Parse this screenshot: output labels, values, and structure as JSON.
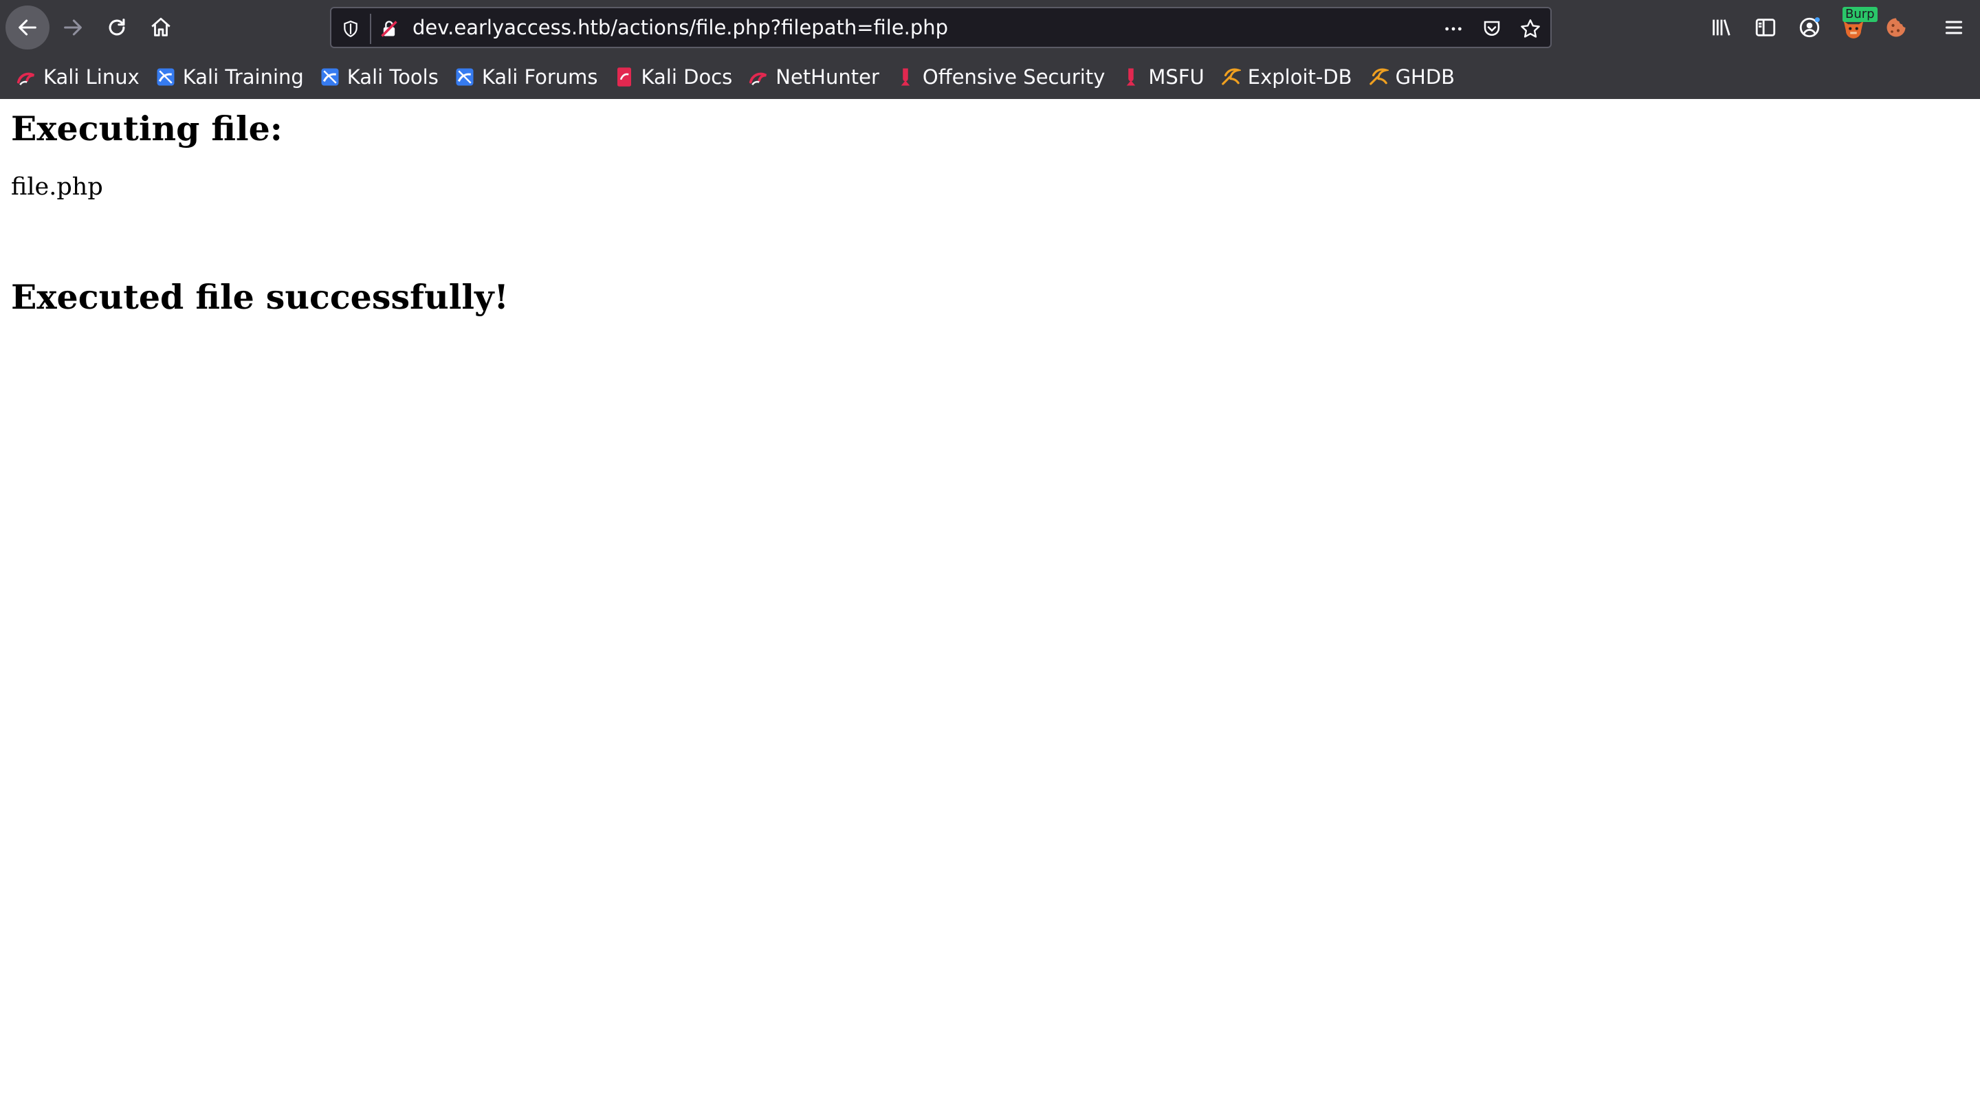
{
  "browser": {
    "url": "dev.earlyaccess.htb/actions/file.php?filepath=file.php",
    "burp_badge": "Burp",
    "accent_colors": {
      "chrome_bg": "#38383d",
      "url_bg": "#1c1b22",
      "burp_green": "#2ac769"
    }
  },
  "bookmarks": [
    {
      "label": "Kali Linux",
      "icon": "kali-dragon-icon"
    },
    {
      "label": "Kali Training",
      "icon": "kali-training-icon"
    },
    {
      "label": "Kali Tools",
      "icon": "kali-tools-icon"
    },
    {
      "label": "Kali Forums",
      "icon": "kali-forums-icon"
    },
    {
      "label": "Kali Docs",
      "icon": "kali-docs-icon"
    },
    {
      "label": "NetHunter",
      "icon": "nethunter-icon"
    },
    {
      "label": "Offensive Security",
      "icon": "offsec-icon"
    },
    {
      "label": "MSFU",
      "icon": "msfu-icon"
    },
    {
      "label": "Exploit-DB",
      "icon": "exploitdb-icon"
    },
    {
      "label": "GHDB",
      "icon": "ghdb-icon"
    }
  ],
  "page": {
    "exec_heading": "Executing file:",
    "file_name": "file.php",
    "success_heading": "Executed file successfully!"
  }
}
